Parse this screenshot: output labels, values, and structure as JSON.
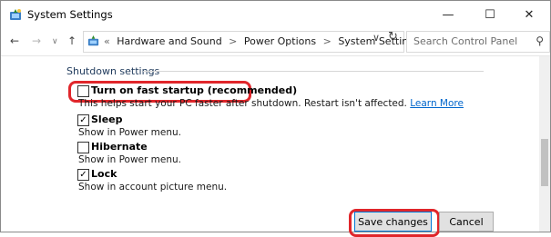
{
  "window": {
    "title": "System Settings",
    "min_glyph": "—",
    "max_glyph": "☐",
    "close_glyph": "✕"
  },
  "nav": {
    "back": "←",
    "forward": "→",
    "recent": "∨",
    "up": "↑",
    "prefix": "«",
    "crumbs": [
      "Hardware and Sound",
      "Power Options",
      "System Settings"
    ],
    "separator": ">",
    "dropdown": "∨",
    "refresh": "↻"
  },
  "search": {
    "placeholder": "Search Control Panel",
    "icon": "⚲"
  },
  "section": {
    "title": "Shutdown settings"
  },
  "options": [
    {
      "label": "Turn on fast startup (recommended)",
      "checked": false,
      "description": "This helps start your PC faster after shutdown. Restart isn't affected.",
      "link": "Learn More"
    },
    {
      "label": "Sleep",
      "checked": true,
      "description": "Show in Power menu."
    },
    {
      "label": "Hibernate",
      "checked": false,
      "description": "Show in Power menu."
    },
    {
      "label": "Lock",
      "checked": true,
      "description": "Show in account picture menu."
    }
  ],
  "check_glyph": "✓",
  "buttons": {
    "save": "Save changes",
    "cancel": "Cancel"
  },
  "colors": {
    "highlight": "#e0262b",
    "section_title": "#1e395b",
    "link": "#0066cc"
  },
  "icons": [
    "control-panel-icon",
    "search-icon",
    "refresh-icon"
  ]
}
